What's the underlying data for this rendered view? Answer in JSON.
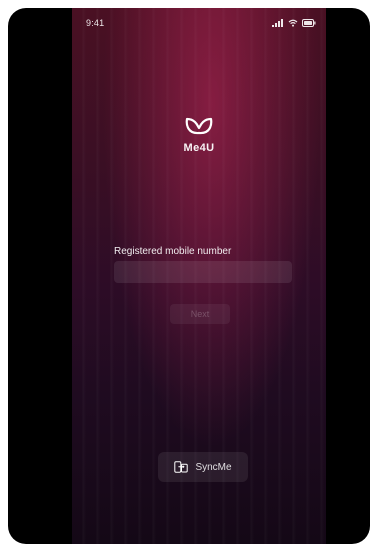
{
  "status_bar": {
    "time": "9:41",
    "icons": [
      "signal-icon",
      "wifi-icon",
      "battery-icon"
    ]
  },
  "logo": {
    "icon": "me4u-logo-icon",
    "brand_name": "Me4U"
  },
  "form": {
    "label": "Registered mobile number",
    "mobile_value": "",
    "mobile_placeholder": "",
    "next_label": "Next"
  },
  "footer": {
    "syncme_icon": "sync-devices-icon",
    "syncme_label": "SyncMe"
  },
  "colors": {
    "background_top": "#4a1023",
    "background_bottom": "#140816",
    "accent": "#be285a",
    "text": "#ffffff"
  }
}
